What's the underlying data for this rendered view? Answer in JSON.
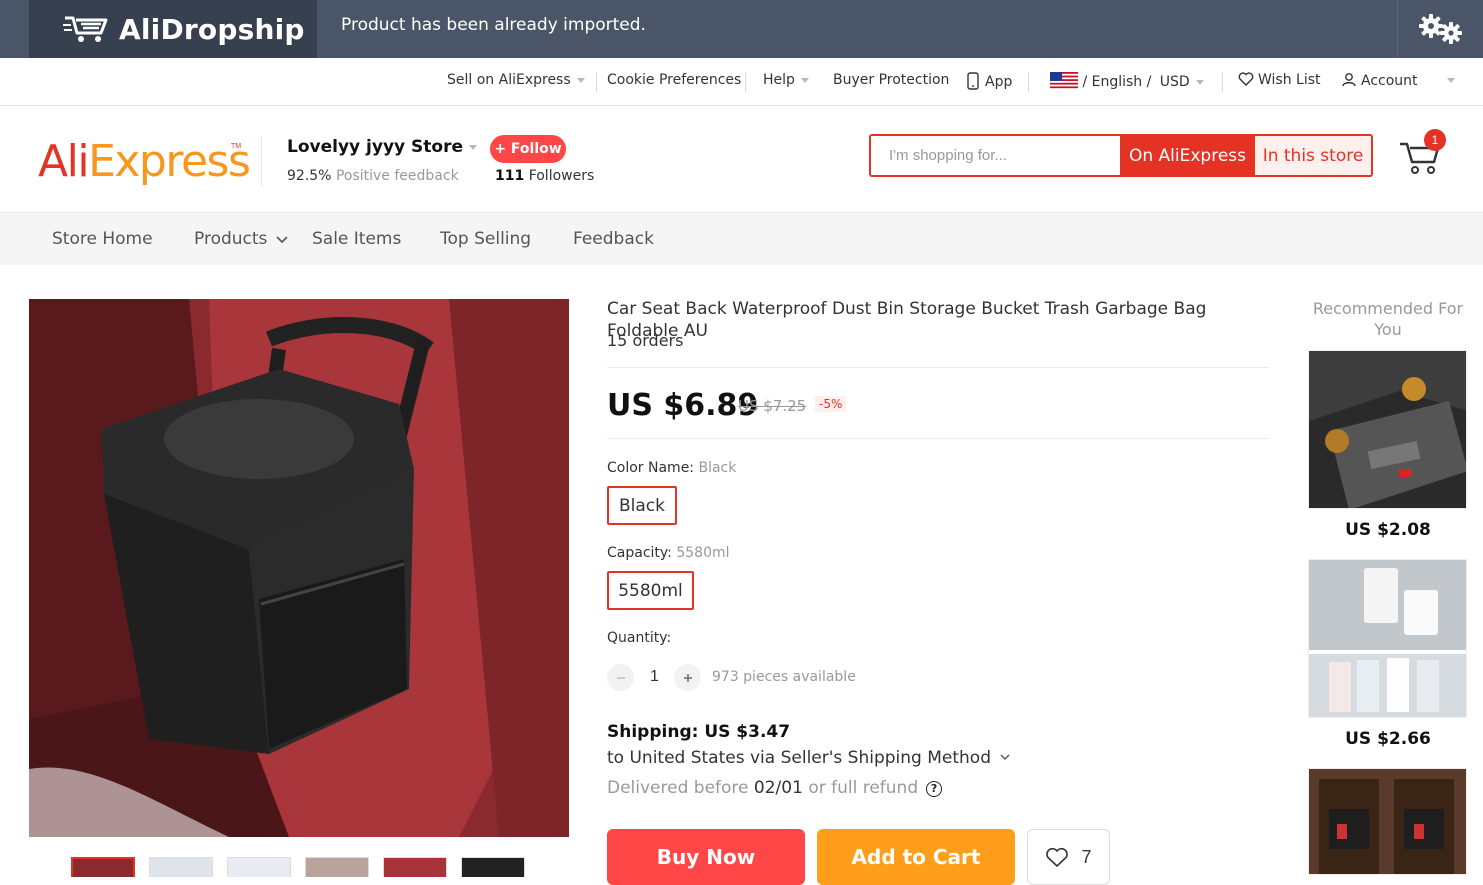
{
  "alidropship": {
    "brand": "AliDropship",
    "message": "Product has been already imported."
  },
  "util_nav": {
    "sell": "Sell on AliExpress",
    "cookie": "Cookie Preferences",
    "help": "Help",
    "buyer_protection": "Buyer Protection",
    "app": "App",
    "language": "/ English /",
    "currency": "USD",
    "wish_list": "Wish List",
    "account": "Account"
  },
  "store": {
    "logo_a": "Ali",
    "logo_b": "Express",
    "logo_tm": "TM",
    "name": "Lovelyy jyyy Store",
    "feedback_pct": "92.5%",
    "feedback_label": "Positive feedback",
    "follow_label": "+ Follow",
    "followers_count": "111",
    "followers_label": "Followers"
  },
  "search": {
    "placeholder": "I'm shopping for...",
    "btn_aliexpress": "On AliExpress",
    "btn_store": "In this store",
    "cart_count": "1"
  },
  "store_nav": {
    "home": "Store Home",
    "products": "Products",
    "sale": "Sale Items",
    "top": "Top Selling",
    "feedback": "Feedback"
  },
  "product": {
    "title": "Car Seat Back Waterproof Dust Bin Storage Bucket Trash Garbage Bag Foldable AU",
    "orders": "15 orders",
    "price": "US $6.89",
    "old_price": "US $7.25",
    "discount": "-5%",
    "color_label": "Color Name:",
    "color_value": "Black",
    "color_option": "Black",
    "capacity_label": "Capacity:",
    "capacity_value": "5580ml",
    "capacity_option": "5580ml",
    "quantity_label": "Quantity:",
    "quantity_value": "1",
    "available": "973 pieces available",
    "shipping_title": "Shipping: US $3.47",
    "shipping_via": "to United States via Seller's Shipping Method",
    "delivered_before": "Delivered before",
    "delivery_date": "02/01",
    "delivery_suffix": "or full refund",
    "buy_now": "Buy Now",
    "add_to_cart": "Add to Cart",
    "wish_count": "7"
  },
  "recommended": {
    "title": "Recommended For You",
    "items": [
      {
        "price": "US $2.08"
      },
      {
        "price": "US $2.66"
      }
    ]
  },
  "colors": {
    "accent": "#e43225",
    "buy": "#ff4747",
    "cart": "#ff9e1b",
    "topbar": "#4a5568"
  }
}
